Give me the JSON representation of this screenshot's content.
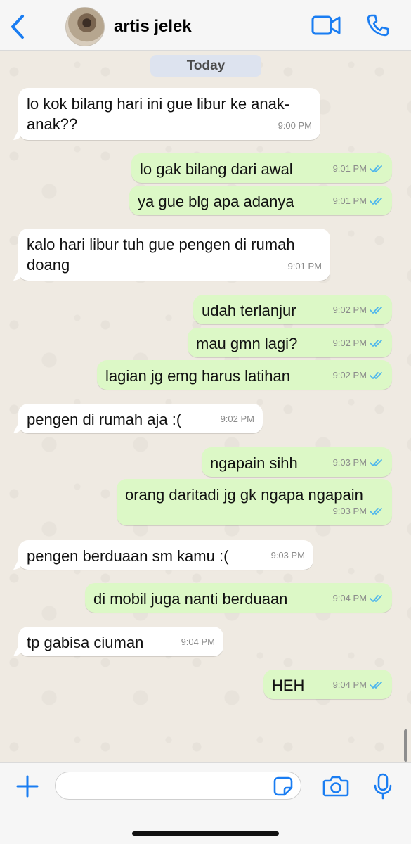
{
  "header": {
    "contact_name": "artis jelek"
  },
  "chat": {
    "date_label": "Today",
    "messages": [
      {
        "dir": "in",
        "text": "lo kok bilang hari ini gue libur ke anak-anak??",
        "time": "9:00 PM"
      },
      {
        "dir": "out",
        "text": "lo gak bilang dari awal",
        "time": "9:01 PM",
        "status": "read"
      },
      {
        "dir": "out",
        "text": "ya gue blg apa adanya",
        "time": "9:01 PM",
        "status": "read"
      },
      {
        "dir": "in",
        "text": "kalo hari libur tuh gue pengen di rumah doang",
        "time": "9:01 PM"
      },
      {
        "dir": "out",
        "text": "udah terlanjur",
        "time": "9:02 PM",
        "status": "read"
      },
      {
        "dir": "out",
        "text": "mau gmn lagi?",
        "time": "9:02 PM",
        "status": "read"
      },
      {
        "dir": "out",
        "text": "lagian jg emg harus latihan",
        "time": "9:02 PM",
        "status": "read"
      },
      {
        "dir": "in",
        "text": "pengen di rumah aja :(",
        "time": "9:02 PM"
      },
      {
        "dir": "out",
        "text": "ngapain sihh",
        "time": "9:03 PM",
        "status": "read"
      },
      {
        "dir": "out",
        "text": "orang daritadi jg gk ngapa ngapain",
        "time": "9:03 PM",
        "status": "read"
      },
      {
        "dir": "in",
        "text": "pengen berduaan sm kamu :(",
        "time": "9:03 PM"
      },
      {
        "dir": "out",
        "text": "di mobil juga nanti berduaan",
        "time": "9:04 PM",
        "status": "read"
      },
      {
        "dir": "in",
        "text": "tp gabisa ciuman",
        "time": "9:04 PM"
      },
      {
        "dir": "out",
        "text": "HEH",
        "time": "9:04 PM",
        "status": "read"
      }
    ]
  },
  "composer": {
    "placeholder": "",
    "value": ""
  },
  "icons": {
    "back": "chevron-left-icon",
    "video": "video-camera-icon",
    "call": "phone-icon",
    "plus": "plus-icon",
    "sticker": "sticker-icon",
    "camera": "camera-icon",
    "mic": "microphone-icon",
    "read": "double-check-icon"
  },
  "colors": {
    "accent": "#1a7df2",
    "outgoing_bubble": "#dcf8c6",
    "incoming_bubble": "#ffffff",
    "read_ticks": "#4fb6ec",
    "chat_bg": "#efeae2"
  }
}
